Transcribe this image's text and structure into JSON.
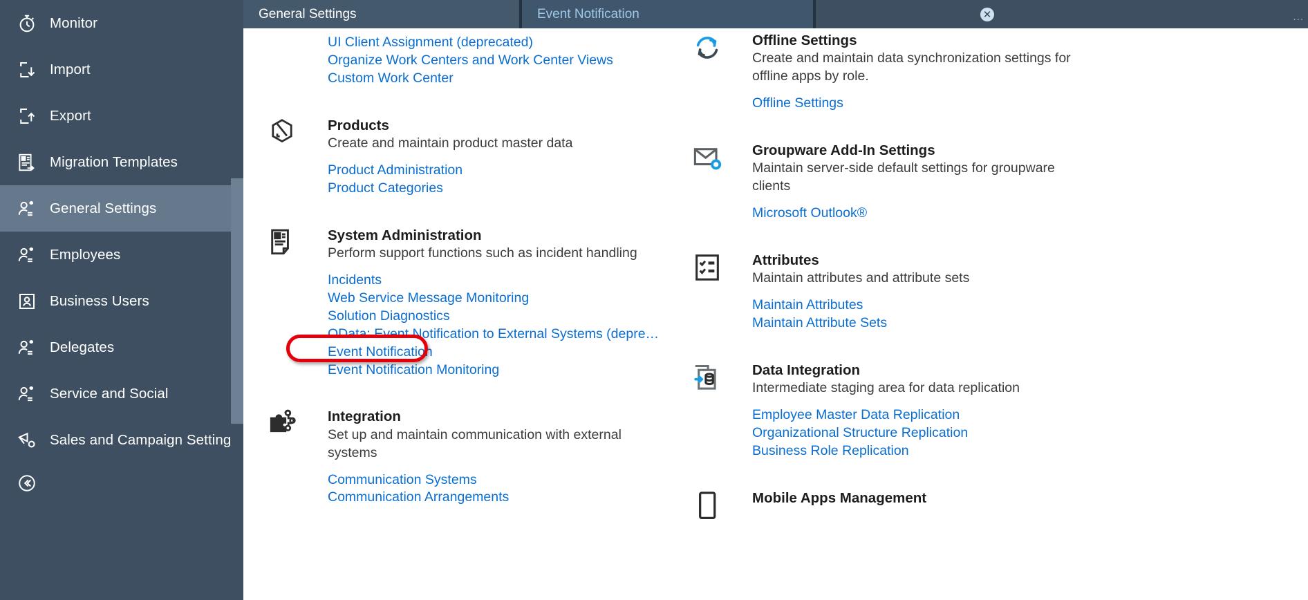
{
  "sidebar": {
    "items": [
      {
        "label": "Monitor",
        "icon": "stopwatch-icon",
        "active": false
      },
      {
        "label": "Import",
        "icon": "import-icon",
        "active": false
      },
      {
        "label": "Export",
        "icon": "export-icon",
        "active": false
      },
      {
        "label": "Migration Templates",
        "icon": "migration-template-icon",
        "active": false
      },
      {
        "label": "General Settings",
        "icon": "user-settings-icon",
        "active": true
      },
      {
        "label": "Employees",
        "icon": "user-settings-icon",
        "active": false
      },
      {
        "label": "Business Users",
        "icon": "user-card-icon",
        "active": false
      },
      {
        "label": "Delegates",
        "icon": "user-settings-icon",
        "active": false
      },
      {
        "label": "Service and Social",
        "icon": "user-settings-icon",
        "active": false
      },
      {
        "label": "Sales and Campaign Settings",
        "icon": "megaphone-gear-icon",
        "active": false
      }
    ],
    "collapse_icon": "collapse-left-icon"
  },
  "tabbar": {
    "tabs": [
      {
        "label": "General Settings",
        "selected": true,
        "closable": false
      },
      {
        "label": "Event Notification",
        "selected": false,
        "closable": true
      }
    ],
    "close_icon": "close-icon",
    "overflow_icon": "overflow-dots-icon",
    "overflow_label": "..."
  },
  "main": {
    "left_column": [
      {
        "id": "work-centers",
        "icon": null,
        "title": "",
        "desc": "",
        "partial": true,
        "links": [
          "UI Client Assignment (deprecated)",
          "Organize Work Centers and Work Center Views",
          "Custom Work Center"
        ]
      },
      {
        "id": "products",
        "icon": "product-box-icon",
        "title": "Products",
        "desc": "Create and maintain product master data",
        "links": [
          "Product Administration",
          "Product Categories"
        ]
      },
      {
        "id": "system-administration",
        "icon": "system-admin-icon",
        "title": "System Administration",
        "desc": "Perform support functions such as incident handling",
        "links": [
          "Incidents",
          "Web Service Message Monitoring",
          "Solution Diagnostics",
          "OData: Event Notification to External Systems (depre…",
          "Event Notification",
          "Event Notification Monitoring"
        ],
        "highlighted_link": "Event Notification"
      },
      {
        "id": "integration",
        "icon": "puzzle-icon",
        "title": "Integration",
        "desc": "Set up and maintain communication with external systems",
        "links": [
          "Communication Systems",
          "Communication Arrangements"
        ]
      }
    ],
    "right_column": [
      {
        "id": "offline-settings",
        "icon": "sync-refresh-icon",
        "title": "Offline Settings",
        "desc": "Create and maintain data synchronization settings for offline apps by role.",
        "links": [
          "Offline Settings"
        ]
      },
      {
        "id": "groupware-add-in-settings",
        "icon": "mail-gear-icon",
        "title": "Groupware Add-In Settings",
        "desc": "Maintain server-side default settings for groupware clients",
        "links": [
          "Microsoft Outlook®"
        ]
      },
      {
        "id": "attributes",
        "icon": "checklist-icon",
        "title": "Attributes",
        "desc": "Maintain attributes and attribute sets",
        "links": [
          "Maintain Attributes",
          "Maintain Attribute Sets"
        ]
      },
      {
        "id": "data-integration",
        "icon": "data-staging-icon",
        "title": "Data Integration",
        "desc": "Intermediate staging area for data replication",
        "links": [
          "Employee Master Data Replication",
          "Organizational Structure Replication",
          "Business Role Replication"
        ]
      },
      {
        "id": "mobile-apps-management",
        "icon": "mobile-device-icon",
        "title": "Mobile Apps Management",
        "desc": "",
        "links": []
      }
    ]
  },
  "colors": {
    "sidebar_bg": "#3d4f60",
    "sidebar_active": "#65788c",
    "link_blue": "#0a6ed1",
    "annotation_red": "#e3000b",
    "tab_active_bg": "#45596d",
    "content_bg": "#ffffff"
  }
}
